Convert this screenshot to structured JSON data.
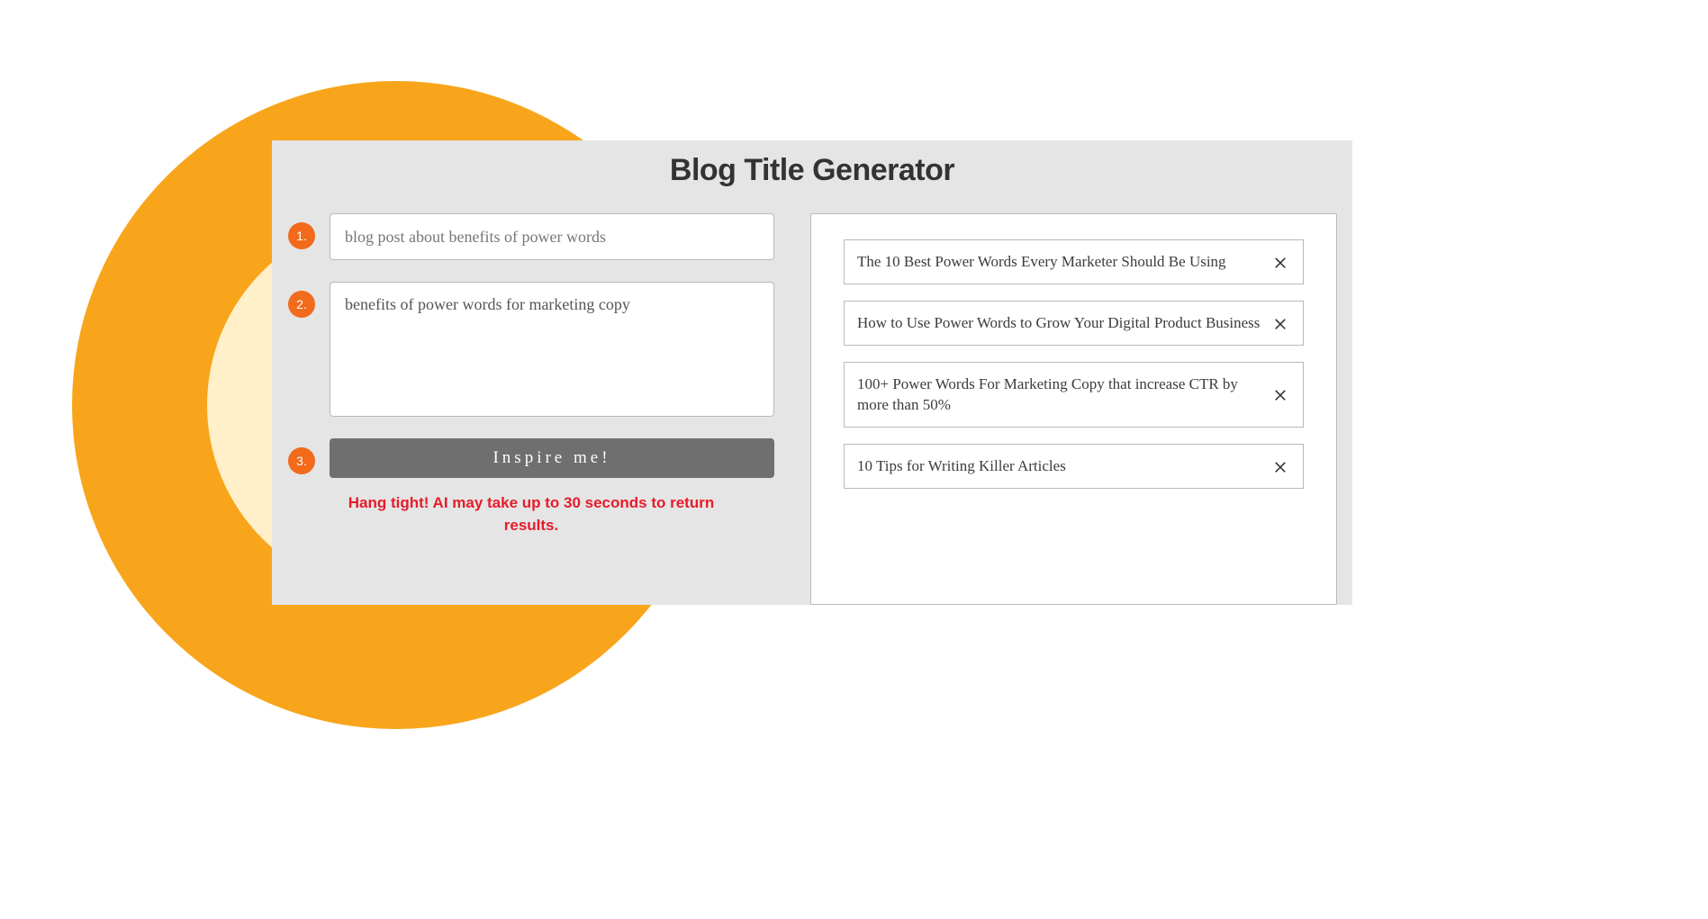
{
  "title": "Blog Title Generator",
  "steps": {
    "one": {
      "badge": "1.",
      "placeholder": "blog post about benefits of power words"
    },
    "two": {
      "badge": "2.",
      "value": "benefits of power words for marketing copy"
    },
    "three": {
      "badge": "3.",
      "button_label": "Inspire me!"
    }
  },
  "status_message": "Hang tight! AI may take up to 30 seconds to return results.",
  "results": [
    "The 10 Best Power Words Every Marketer Should Be Using",
    "How to Use Power Words to Grow Your Digital Product Business",
    "100+ Power Words For Marketing Copy that increase CTR by more than 50%",
    "10 Tips for Writing Killer Articles"
  ]
}
